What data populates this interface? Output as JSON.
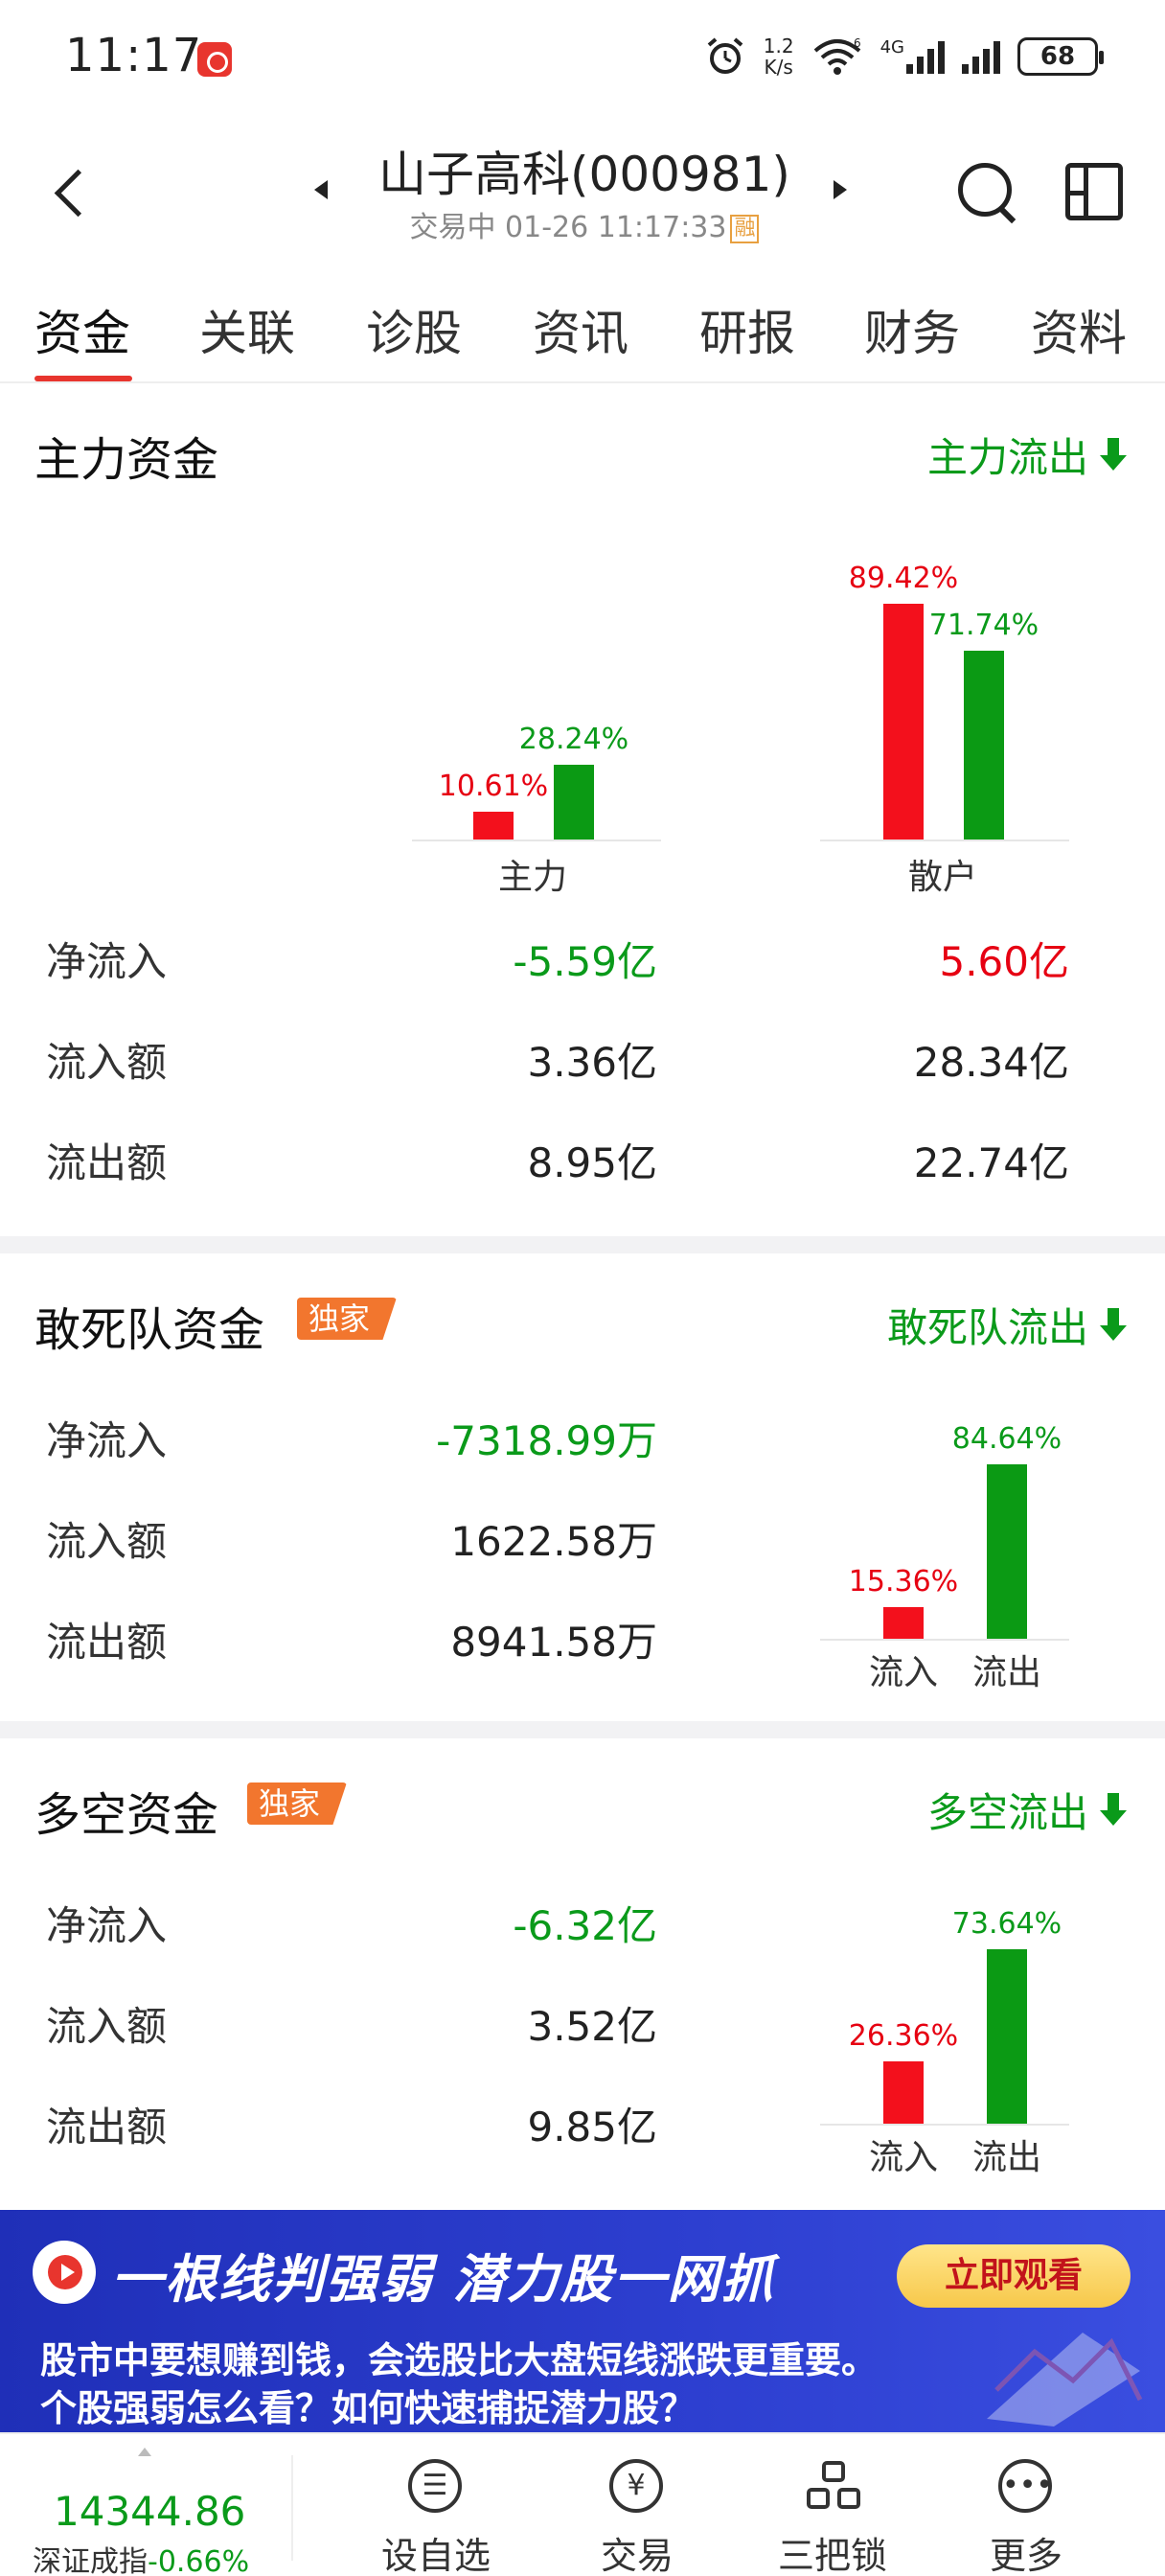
{
  "status_bar": {
    "time": "11:17",
    "speed_top": "1.2",
    "speed_bottom": "K/s",
    "network": "4G",
    "wifi_tag": "6",
    "battery": "68"
  },
  "header": {
    "title": "山子高科(000981)",
    "subtitle": "交易中 01-26 11:17:33",
    "rong_badge": "融"
  },
  "tabs": [
    "资金",
    "关联",
    "诊股",
    "资讯",
    "研报",
    "财务",
    "资料"
  ],
  "main_force": {
    "title": "主力资金",
    "flow_link": "主力流出",
    "chart_data": {
      "type": "bar",
      "categories": [
        "主力",
        "散户"
      ],
      "series": [
        {
          "values": [
            10.61,
            89.42
          ],
          "labels": [
            "10.61%",
            "89.42%"
          ],
          "color": "#f3101c"
        },
        {
          "values": [
            28.24,
            71.74
          ],
          "labels": [
            "28.24%",
            "71.74%"
          ],
          "color": "#0b9a14"
        }
      ],
      "ylim": [
        0,
        100
      ]
    },
    "rows": [
      {
        "label": "净流入",
        "main": "-5.59亿",
        "retail": "5.60亿"
      },
      {
        "label": "流入额",
        "main": "3.36亿",
        "retail": "28.34亿"
      },
      {
        "label": "流出额",
        "main": "8.95亿",
        "retail": "22.74亿"
      }
    ]
  },
  "dare_to_die": {
    "title": "敢死队资金",
    "badge": "独家",
    "flow_link": "敢死队流出",
    "rows": [
      {
        "label": "净流入",
        "value": "-7318.99万"
      },
      {
        "label": "流入额",
        "value": "1622.58万"
      },
      {
        "label": "流出额",
        "value": "8941.58万"
      }
    ],
    "chart_data": {
      "type": "bar",
      "categories": [
        "流入",
        "流出"
      ],
      "values": [
        15.36,
        84.64
      ],
      "labels": [
        "15.36%",
        "84.64%"
      ],
      "colors": [
        "#f3101c",
        "#0b9a14"
      ],
      "ylim": [
        0,
        100
      ]
    }
  },
  "long_short": {
    "title": "多空资金",
    "badge": "独家",
    "flow_link": "多空流出",
    "rows": [
      {
        "label": "净流入",
        "value": "-6.32亿"
      },
      {
        "label": "流入额",
        "value": "3.52亿"
      },
      {
        "label": "流出额",
        "value": "9.85亿"
      }
    ],
    "chart_data": {
      "type": "bar",
      "categories": [
        "流入",
        "流出"
      ],
      "values": [
        26.36,
        73.64
      ],
      "labels": [
        "26.36%",
        "73.64%"
      ],
      "colors": [
        "#f3101c",
        "#0b9a14"
      ],
      "ylim": [
        0,
        100
      ]
    }
  },
  "banner": {
    "headline": "一根线判强弱 潜力股一网抓",
    "button": "立即观看",
    "line1": "股市中要想赚到钱，会选股比大盘短线涨跌更重要。",
    "line2": "个股强弱怎么看？如何快速捕捉潜力股？"
  },
  "bottom_bar": {
    "index_value": "14344.86",
    "index_name": "深证成指",
    "index_change": "-0.66%",
    "nav": [
      {
        "label": "设自选",
        "icon": "list-icon"
      },
      {
        "label": "交易",
        "icon": "yen-icon"
      },
      {
        "label": "三把锁",
        "icon": "lock-group-icon"
      },
      {
        "label": "更多",
        "icon": "more-icon"
      }
    ]
  },
  "colors": {
    "up": "#e60012",
    "down": "#0a9a1a",
    "accent": "#e8352e",
    "badge": "#f2762e"
  }
}
